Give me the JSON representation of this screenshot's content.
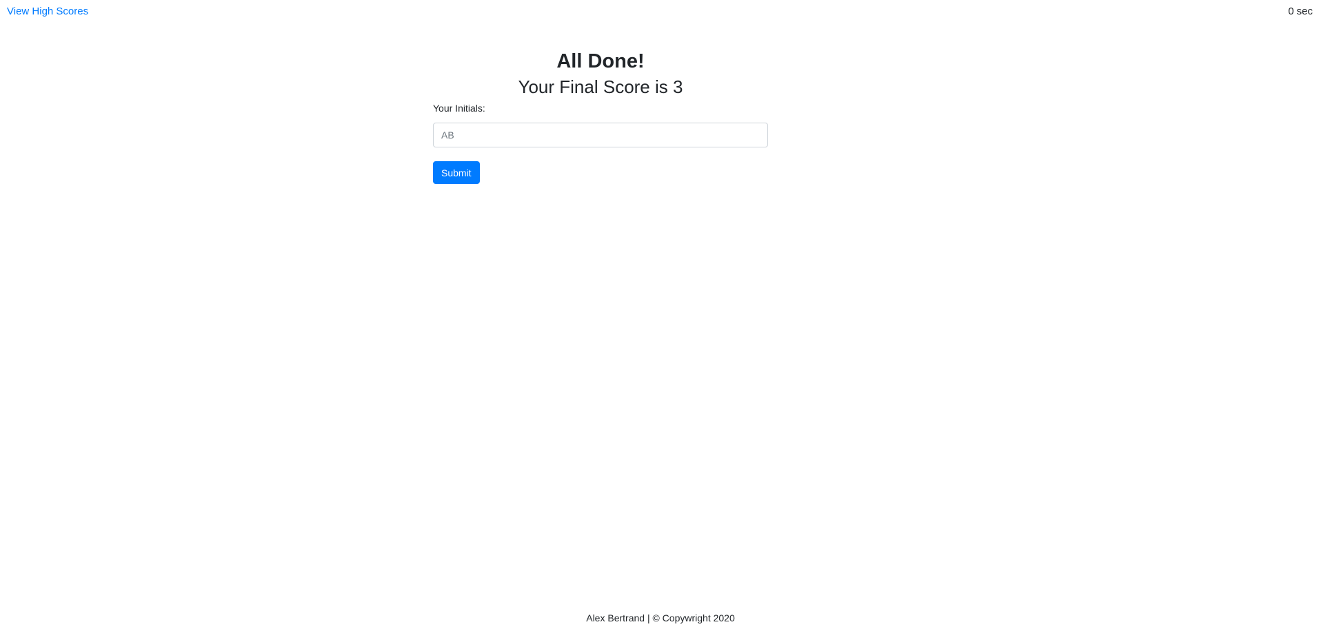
{
  "header": {
    "high_scores_link": "View High Scores",
    "timer_value": "0",
    "timer_unit": "sec"
  },
  "result": {
    "title": "All Done!",
    "score_text": "Your Final Score is 3"
  },
  "form": {
    "initials_label": "Your Initials:",
    "initials_placeholder": "AB",
    "initials_value": "",
    "submit_label": "Submit"
  },
  "footer": {
    "text": "Alex Bertrand | © Copywright 2020"
  },
  "colors": {
    "accent": "#007bff",
    "text": "#212529",
    "input_border": "#ced4da"
  }
}
